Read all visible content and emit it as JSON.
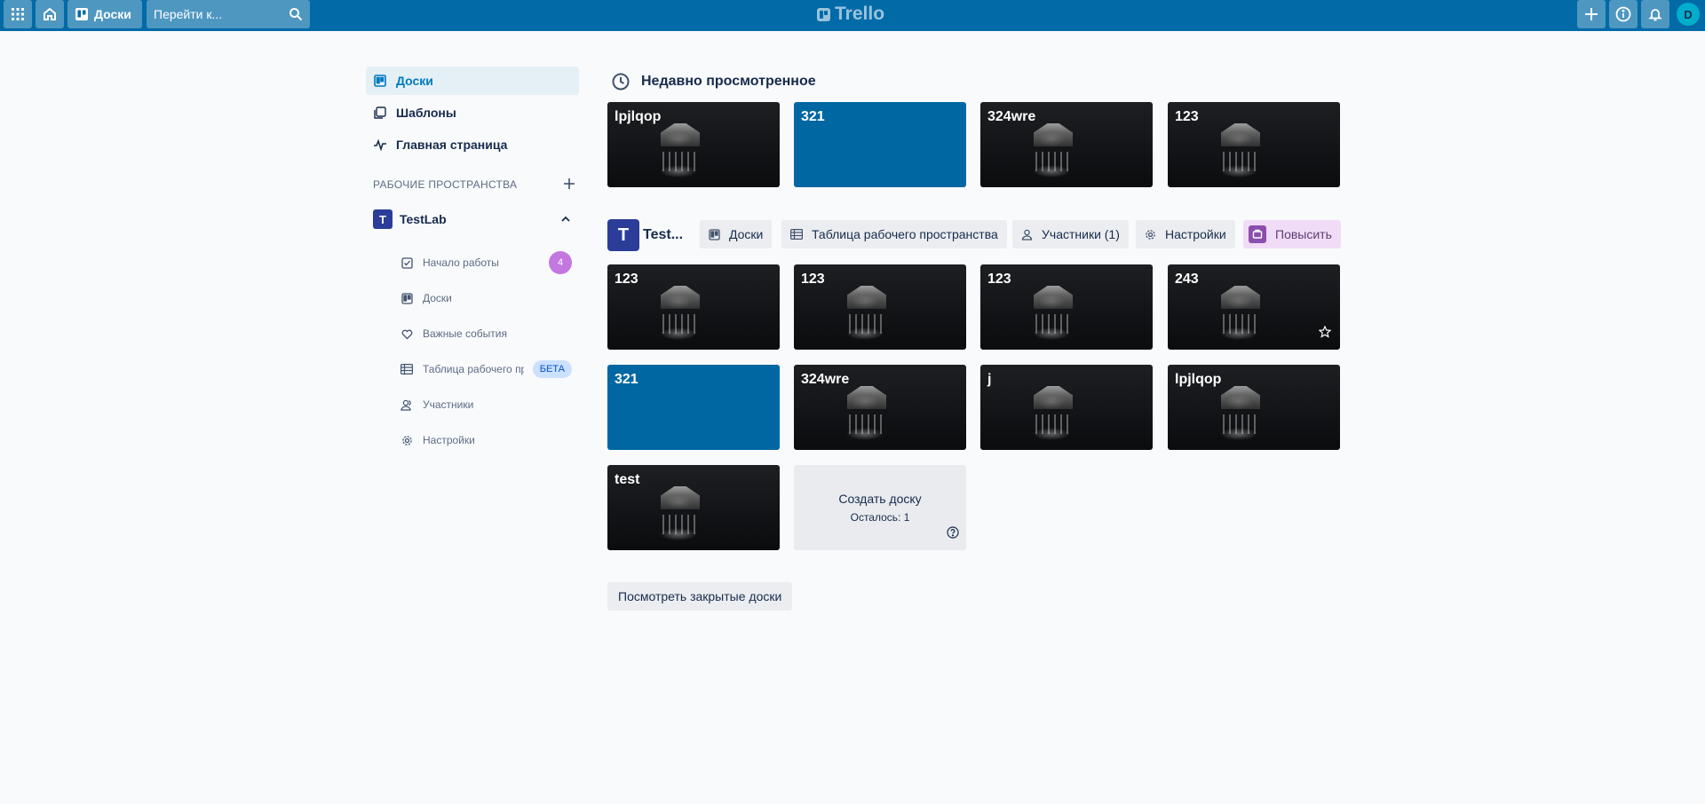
{
  "header": {
    "boards_label": "Доски",
    "search_placeholder": "Перейти к...",
    "logo_text": "Trello",
    "avatar_initial": "D"
  },
  "sidebar": {
    "nav": [
      {
        "label": "Доски",
        "icon": "board-icon",
        "active": true
      },
      {
        "label": "Шаблоны",
        "icon": "template-icon"
      },
      {
        "label": "Главная страница",
        "icon": "activity-icon"
      }
    ],
    "workspaces_label": "РАБОЧИЕ ПРОСТРАНСТВА",
    "workspace": {
      "initial": "T",
      "name": "TestLab"
    },
    "sub_items": [
      {
        "label": "Начало работы",
        "icon": "checklist-icon",
        "badge": "4"
      },
      {
        "label": "Доски",
        "icon": "board-icon"
      },
      {
        "label": "Важные события",
        "icon": "heart-icon"
      },
      {
        "label": "Таблица рабочего пр...",
        "icon": "table-icon",
        "badge": "БЕТА"
      },
      {
        "label": "Участники",
        "icon": "members-icon"
      },
      {
        "label": "Настройки",
        "icon": "gear-icon"
      }
    ]
  },
  "recent": {
    "title": "Недавно просмотренное",
    "boards": [
      {
        "title": "lpjlqop",
        "bg": "image"
      },
      {
        "title": "321",
        "bg": "blue"
      },
      {
        "title": "324wre",
        "bg": "image"
      },
      {
        "title": "123",
        "bg": "image"
      }
    ]
  },
  "workspace_section": {
    "initial": "T",
    "name": "Test...",
    "chips": {
      "boards": "Доски",
      "table": "Таблица рабочего пространства",
      "members": "Участники (1)",
      "settings": "Настройки",
      "upgrade": "Повысить"
    },
    "boards": [
      {
        "title": "123",
        "bg": "image"
      },
      {
        "title": "123",
        "bg": "image"
      },
      {
        "title": "123",
        "bg": "image"
      },
      {
        "title": "243",
        "bg": "image",
        "starred_visible": true
      },
      {
        "title": "321",
        "bg": "blue"
      },
      {
        "title": "324wre",
        "bg": "image"
      },
      {
        "title": "j",
        "bg": "image"
      },
      {
        "title": "lpjlqop",
        "bg": "image"
      },
      {
        "title": "test",
        "bg": "image"
      }
    ],
    "create": {
      "label": "Создать доску",
      "remaining": "Осталось: 1"
    }
  },
  "closed_boards_button": "Посмотреть закрытые доски",
  "colors": {
    "header": "#026aa7",
    "board_blue": "#0067a3",
    "accent": "#0079bf"
  }
}
